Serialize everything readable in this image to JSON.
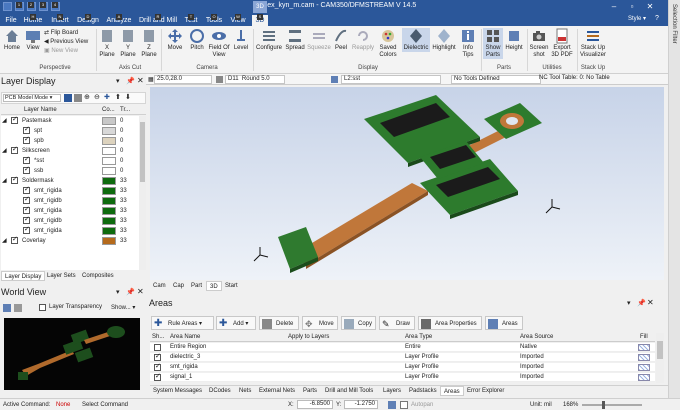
{
  "window": {
    "title": "flex_kyn_m.cam - CAM350/DFMSTREAM V 14.5",
    "context_tab": "3D",
    "style_label": "Style"
  },
  "quick_access": {
    "keytips": [
      "1",
      "2",
      "3",
      "4"
    ]
  },
  "ribbon_tabs": [
    {
      "label": "File",
      "key": ""
    },
    {
      "label": "Home",
      "key": "H"
    },
    {
      "label": "Insert",
      "key": "N"
    },
    {
      "label": "Design",
      "key": "D"
    },
    {
      "label": "Analyze",
      "key": "A"
    },
    {
      "label": "Drill and Mill",
      "key": "R"
    },
    {
      "label": "Test",
      "key": "T"
    },
    {
      "label": "Tools",
      "key": "O"
    },
    {
      "label": "View",
      "key": "W"
    },
    {
      "label": "3D",
      "key": "S"
    }
  ],
  "ribbon": {
    "home": "Home",
    "view": "View",
    "flip_board": "Flip Board",
    "previous_view": "Previous View",
    "new_view": "New View",
    "x_plane": "X Plane",
    "y_plane": "Y Plane",
    "z_plane": "Z Plane",
    "move": "Move",
    "pitch": "Pitch",
    "field_of_view": "Field Of View",
    "level": "Level",
    "configure": "Configure",
    "spread": "Spread",
    "squeeze": "Squeeze",
    "peel": "Peel",
    "reapply": "Reapply",
    "saved_colors": "Saved Colors",
    "dielectric": "Dielectric",
    "highlight": "Highlight",
    "info_tips": "Info Tips",
    "show_parts": "Show Parts",
    "height": "Height",
    "screenshot": "Screen shot",
    "export_3d_pdf": "Export 3D PDF",
    "stack_up_visualizer": "Stack Up Visualizer",
    "groups": {
      "perspective": "Perspective",
      "axis_cut": "Axis Cut",
      "camera": "Camera",
      "display": "Display",
      "parts": "Parts",
      "utilities": "Utilities",
      "stack_up": "Stack Up"
    }
  },
  "layer_display": {
    "title": "Layer Display",
    "mode": "PCB Model Mode",
    "columns": {
      "name": "Layer Name",
      "color": "Co...",
      "transparency": "Tr..."
    },
    "rows": [
      {
        "name": "Pastemask",
        "group": true,
        "color": "#c8c8c8",
        "tr": "0"
      },
      {
        "name": "spt",
        "group": false,
        "color": "#d8d8d8",
        "tr": "0"
      },
      {
        "name": "spb",
        "group": false,
        "color": "#ddd3be",
        "tr": "0"
      },
      {
        "name": "Silkscreen",
        "group": true,
        "color": "#ffffff",
        "tr": "0"
      },
      {
        "name": "*sst",
        "group": false,
        "color": "#ffffff",
        "tr": "0"
      },
      {
        "name": "ssb",
        "group": false,
        "color": "#ffffff",
        "tr": "0"
      },
      {
        "name": "Soldermask",
        "group": true,
        "color": "#0e6a0e",
        "tr": "33"
      },
      {
        "name": "smt_rigida",
        "group": false,
        "color": "#0e6a0e",
        "tr": "33"
      },
      {
        "name": "smt_rigidb",
        "group": false,
        "color": "#0e6a0e",
        "tr": "33"
      },
      {
        "name": "smt_rigida",
        "group": false,
        "color": "#0e6a0e",
        "tr": "33"
      },
      {
        "name": "smt_rigidb",
        "group": false,
        "color": "#0e6a0e",
        "tr": "33"
      },
      {
        "name": "smt_rigida",
        "group": false,
        "color": "#0e6a0e",
        "tr": "33"
      },
      {
        "name": "Coverlay",
        "group": true,
        "color": "#b56a1c",
        "tr": "33"
      }
    ],
    "tabs": [
      "Layer Display",
      "Layer Sets",
      "Composites"
    ]
  },
  "world_view": {
    "title": "World View",
    "transparency_label": "Layer Transparency",
    "show_label": "Show..."
  },
  "view_toolbar": {
    "zoom": "25.0,28.0",
    "aperture": "D11",
    "aperture_desc": "Round 5.0",
    "layer": "L2:sst",
    "tools": "No Tools Defined",
    "nc_tool": "NC Tool Table: 0: No Table"
  },
  "view_tabs": [
    "Cam",
    "Cap",
    "Part",
    "3D",
    "Start"
  ],
  "areas": {
    "title": "Areas",
    "buttons": [
      "Rule Areas",
      "Add",
      "Delete",
      "Move",
      "Copy",
      "Draw",
      "Area Properties",
      "Areas"
    ],
    "columns": [
      "Sh...",
      "Area Name",
      "Apply to Layers",
      "Area Type",
      "Area Source",
      "Fill"
    ],
    "rows": [
      {
        "shown": false,
        "name": "Entire Region",
        "layers": "",
        "type": "Entire",
        "source": "Native"
      },
      {
        "shown": true,
        "name": "dielectric_3",
        "layers": "",
        "type": "Layer Profile",
        "source": "Imported"
      },
      {
        "shown": true,
        "name": "smt_rigida",
        "layers": "",
        "type": "Layer Profile",
        "source": "Imported"
      },
      {
        "shown": true,
        "name": "signal_1",
        "layers": "",
        "type": "Layer Profile",
        "source": "Imported"
      }
    ]
  },
  "bottom_tabs": [
    "System Messages",
    "DCodes",
    "Nets",
    "External Nets",
    "Parts",
    "Drill and Mill Tools",
    "Layers",
    "Padstacks",
    "Areas",
    "Error Explorer"
  ],
  "status": {
    "active_command_label": "Active Command:",
    "active_command": "None",
    "select_command": "Select Command",
    "x_label": "X:",
    "x": "-6.8500",
    "y_label": "Y:",
    "y": "-1.2750",
    "autopan": "Autopan",
    "unit": "Unit: mil",
    "zoom": "168%"
  },
  "right_strip": "Selection Filter",
  "colors": {
    "accent": "#2b579a",
    "soldermask": "#0e6a0e",
    "coverlay": "#b56a1c"
  }
}
